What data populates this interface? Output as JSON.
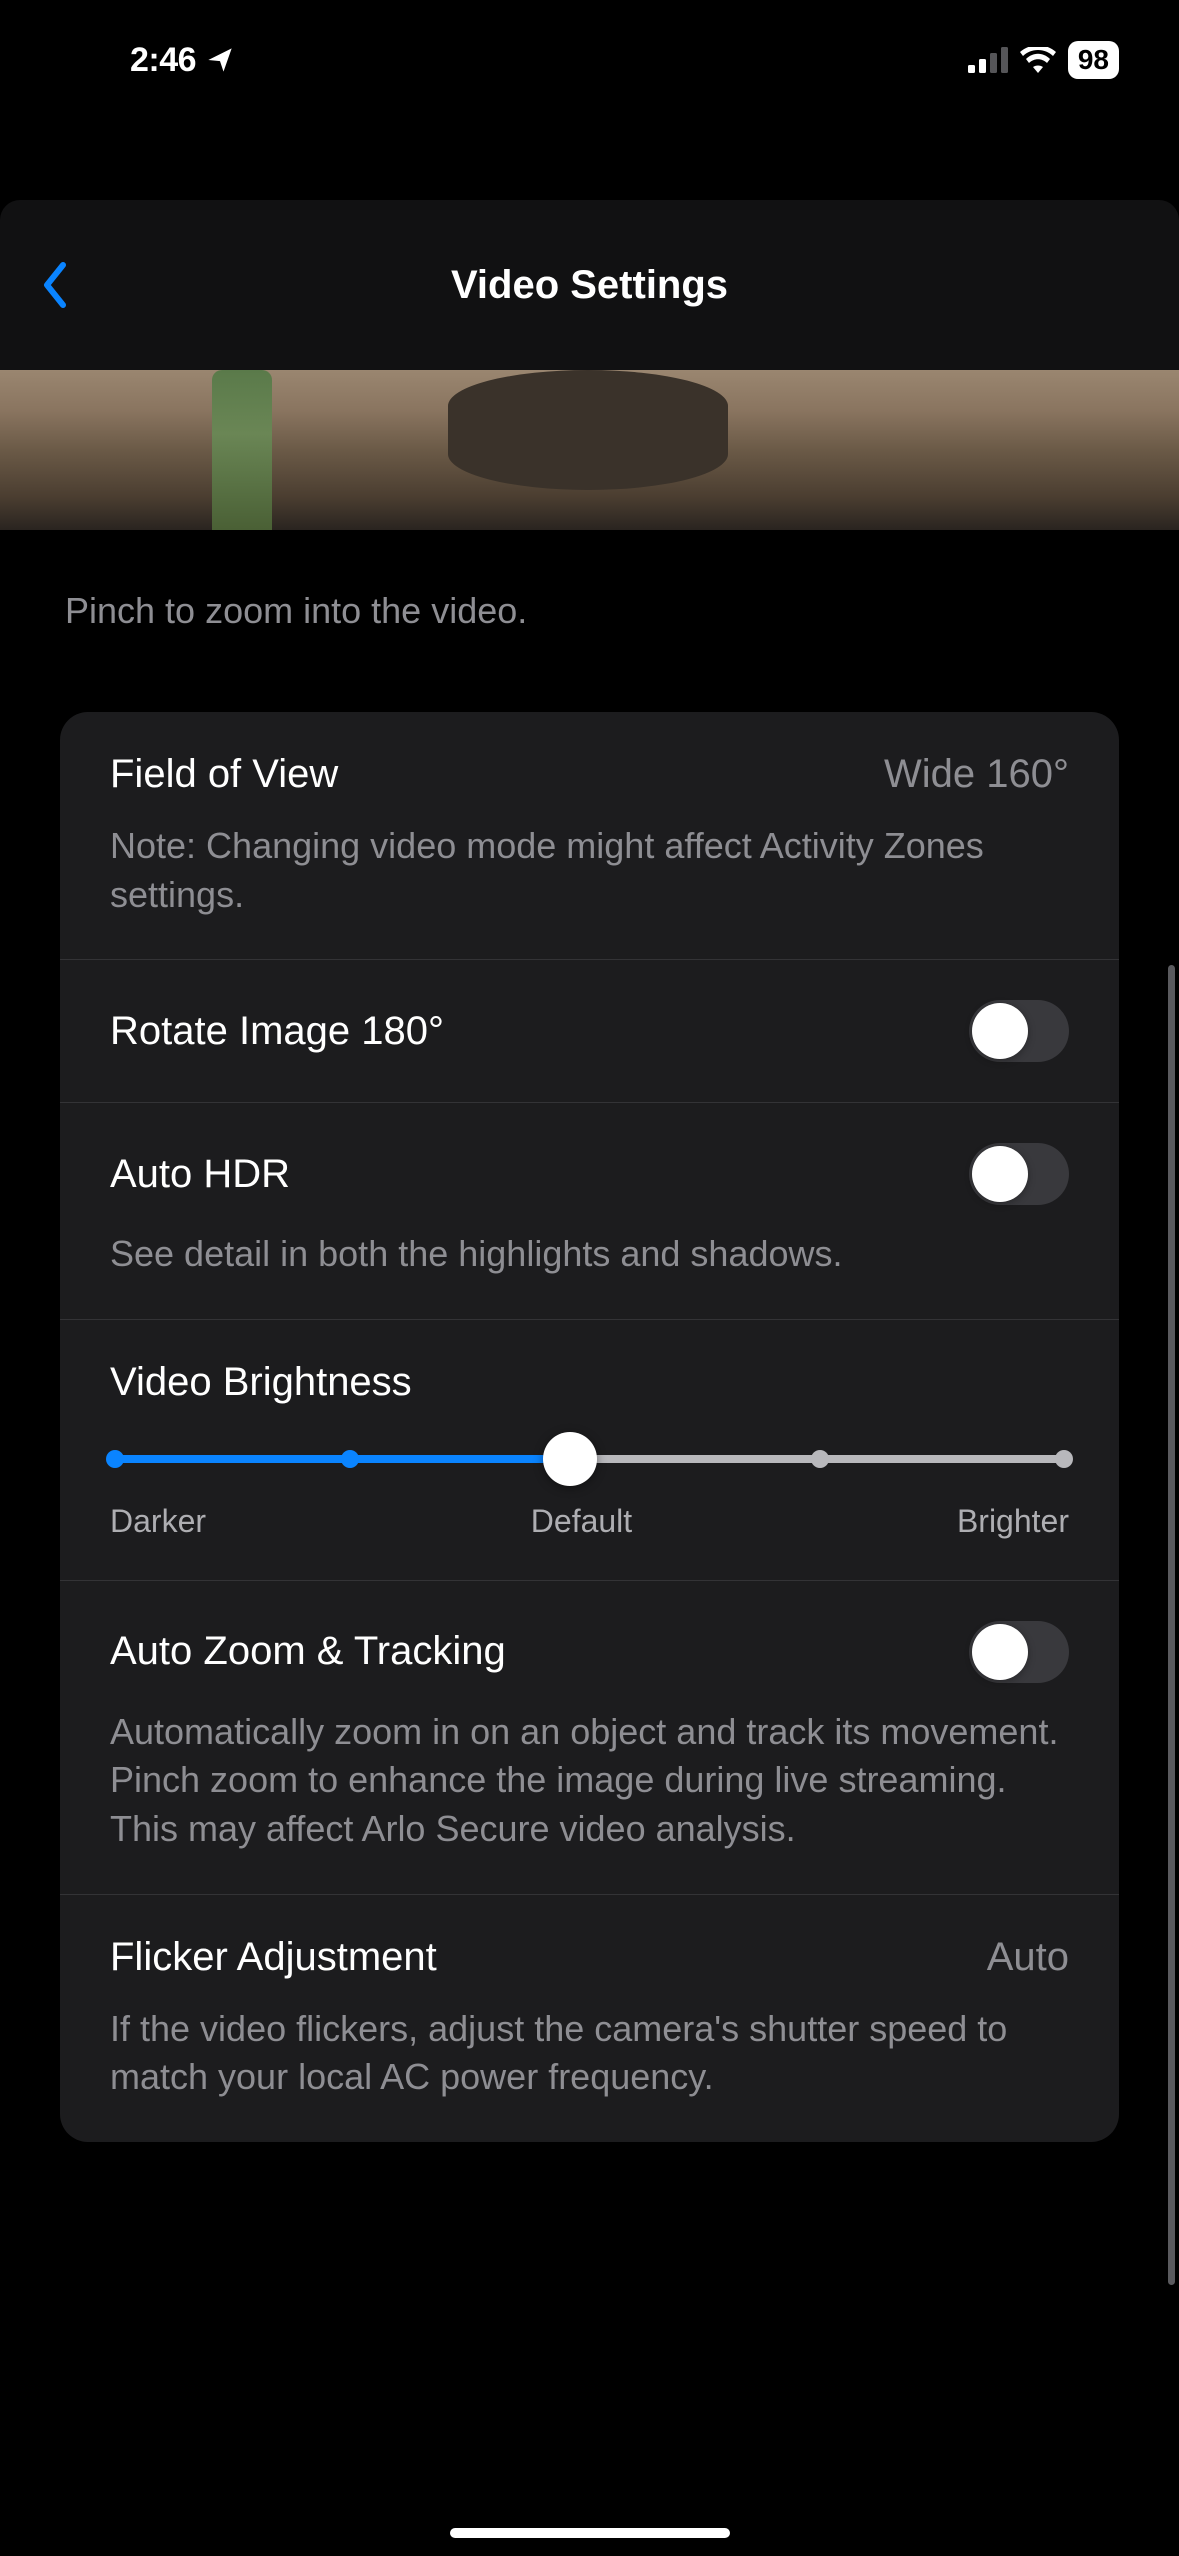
{
  "statusBar": {
    "time": "2:46",
    "battery": "98"
  },
  "nav": {
    "title": "Video Settings"
  },
  "hint": "Pinch to zoom into the video.",
  "settings": {
    "fieldOfView": {
      "label": "Field of View",
      "value": "Wide 160°",
      "note": "Note: Changing video mode might affect Activity Zones settings."
    },
    "rotateImage": {
      "label": "Rotate Image 180°"
    },
    "autoHdr": {
      "label": "Auto HDR",
      "desc": "See detail in both the highlights and shadows."
    },
    "brightness": {
      "label": "Video Brightness",
      "labelDarker": "Darker",
      "labelDefault": "Default",
      "labelBrighter": "Brighter"
    },
    "autoZoom": {
      "label": "Auto Zoom & Tracking",
      "desc": "Automatically zoom in on an object and track its movement. Pinch zoom to enhance the image during live streaming. This may affect Arlo Secure video analysis."
    },
    "flicker": {
      "label": "Flicker Adjustment",
      "value": "Auto",
      "desc": "If the video flickers, adjust the camera's shutter speed to match your local AC power frequency."
    }
  }
}
